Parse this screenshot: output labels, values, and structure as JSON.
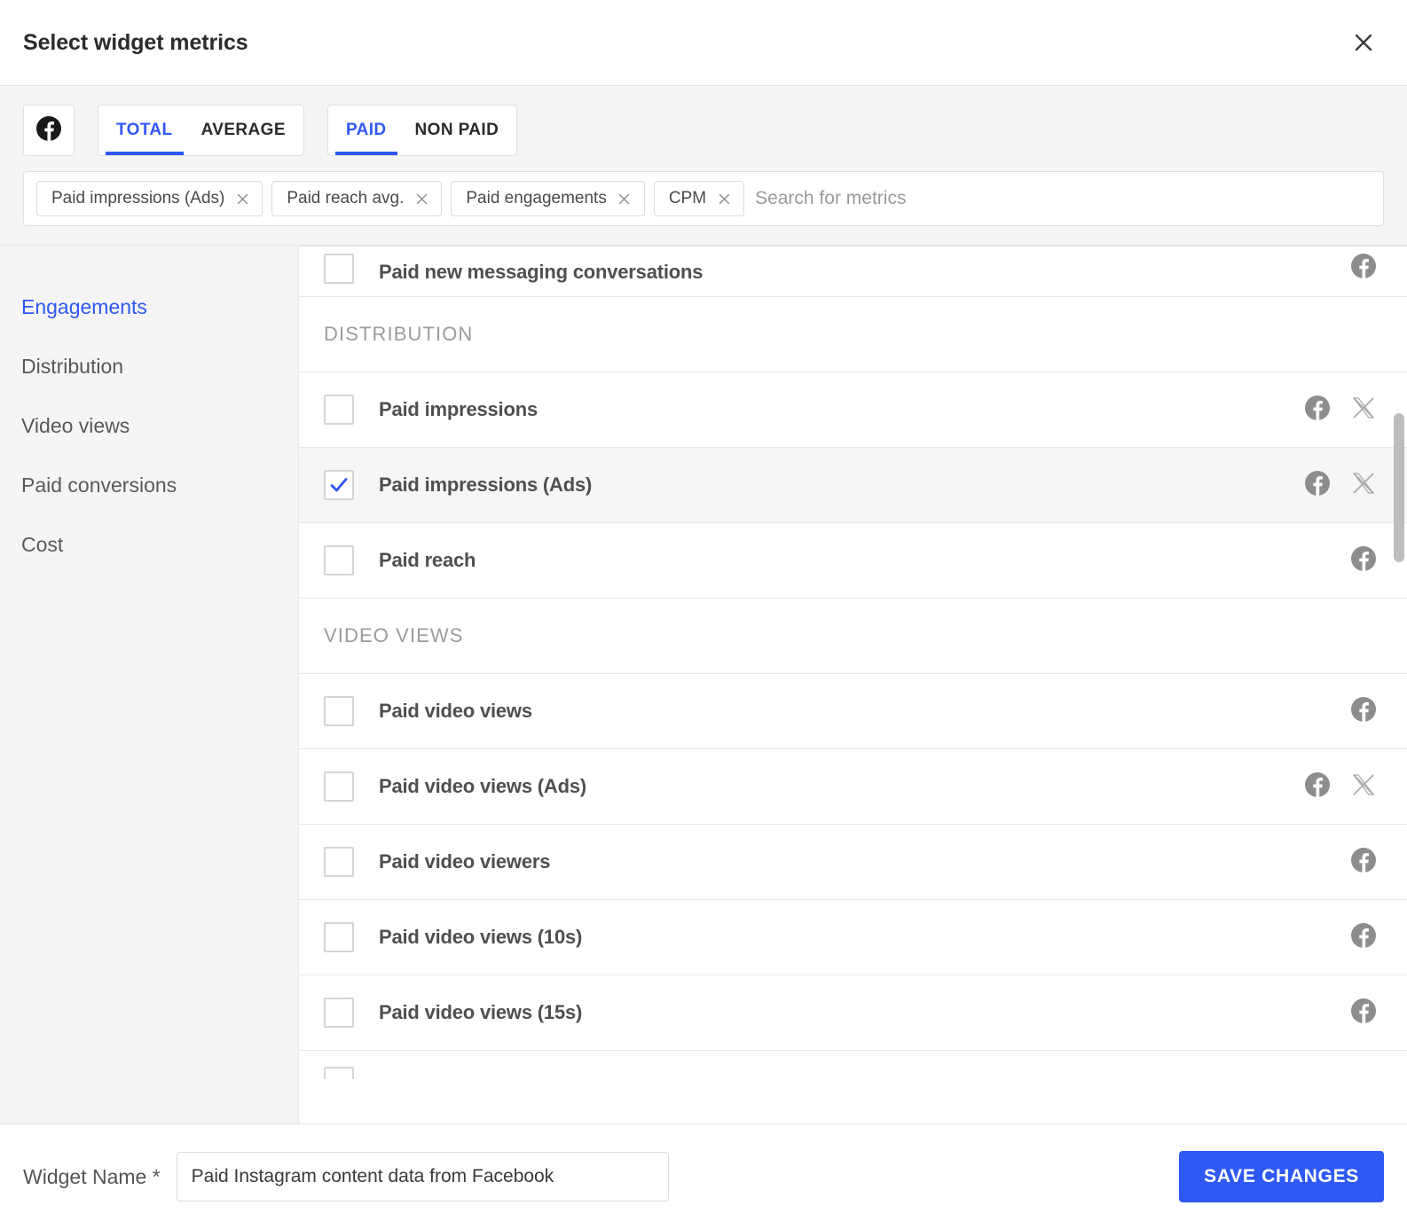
{
  "dialog": {
    "title": "Select widget metrics",
    "close_icon": "close-icon"
  },
  "toolbar": {
    "source_icon": "facebook-icon",
    "aggregation_tabs": [
      {
        "label": "TOTAL",
        "active": true
      },
      {
        "label": "AVERAGE",
        "active": false
      }
    ],
    "paid_tabs": [
      {
        "label": "PAID",
        "active": true
      },
      {
        "label": "NON PAID",
        "active": false
      }
    ],
    "accent_color": "#2f59f5"
  },
  "search": {
    "placeholder": "Search for metrics",
    "value": "",
    "chips": [
      {
        "label": "Paid impressions (Ads)",
        "remove_icon": "close-icon"
      },
      {
        "label": "Paid reach avg.",
        "remove_icon": "close-icon"
      },
      {
        "label": "Paid engagements",
        "remove_icon": "close-icon"
      },
      {
        "label": "CPM",
        "remove_icon": "close-icon"
      }
    ]
  },
  "sidebar": {
    "items": [
      {
        "label": "Engagements",
        "active": true
      },
      {
        "label": "Distribution",
        "active": false
      },
      {
        "label": "Video views",
        "active": false
      },
      {
        "label": "Paid conversions",
        "active": false
      },
      {
        "label": "Cost",
        "active": false
      }
    ]
  },
  "metric_list": {
    "rows": [
      {
        "type": "metric",
        "label": "Paid new messaging conversations",
        "checked": false,
        "networks": [
          "facebook-icon"
        ],
        "partial": "top"
      },
      {
        "type": "group",
        "label": "DISTRIBUTION"
      },
      {
        "type": "metric",
        "label": "Paid impressions",
        "checked": false,
        "networks": [
          "facebook-icon",
          "x-icon"
        ]
      },
      {
        "type": "metric",
        "label": "Paid impressions (Ads)",
        "checked": true,
        "networks": [
          "facebook-icon",
          "x-icon"
        ]
      },
      {
        "type": "metric",
        "label": "Paid reach",
        "checked": false,
        "networks": [
          "facebook-icon"
        ]
      },
      {
        "type": "group",
        "label": "VIDEO VIEWS"
      },
      {
        "type": "metric",
        "label": "Paid video views",
        "checked": false,
        "networks": [
          "facebook-icon"
        ]
      },
      {
        "type": "metric",
        "label": "Paid video views (Ads)",
        "checked": false,
        "networks": [
          "facebook-icon",
          "x-icon"
        ]
      },
      {
        "type": "metric",
        "label": "Paid video viewers",
        "checked": false,
        "networks": [
          "facebook-icon"
        ]
      },
      {
        "type": "metric",
        "label": "Paid video views (10s)",
        "checked": false,
        "networks": [
          "facebook-icon"
        ]
      },
      {
        "type": "metric",
        "label": "Paid video views (15s)",
        "checked": false,
        "networks": [
          "facebook-icon"
        ]
      },
      {
        "type": "metric",
        "label": "",
        "checked": false,
        "networks": [],
        "partial": "bottom"
      }
    ],
    "scrollbar": {
      "thumb_top_pct": 19,
      "thumb_height_pct": 17
    }
  },
  "footer": {
    "widget_name_label": "Widget Name *",
    "widget_name_value": "Paid Instagram content data from Facebook",
    "save_label": "SAVE CHANGES"
  }
}
